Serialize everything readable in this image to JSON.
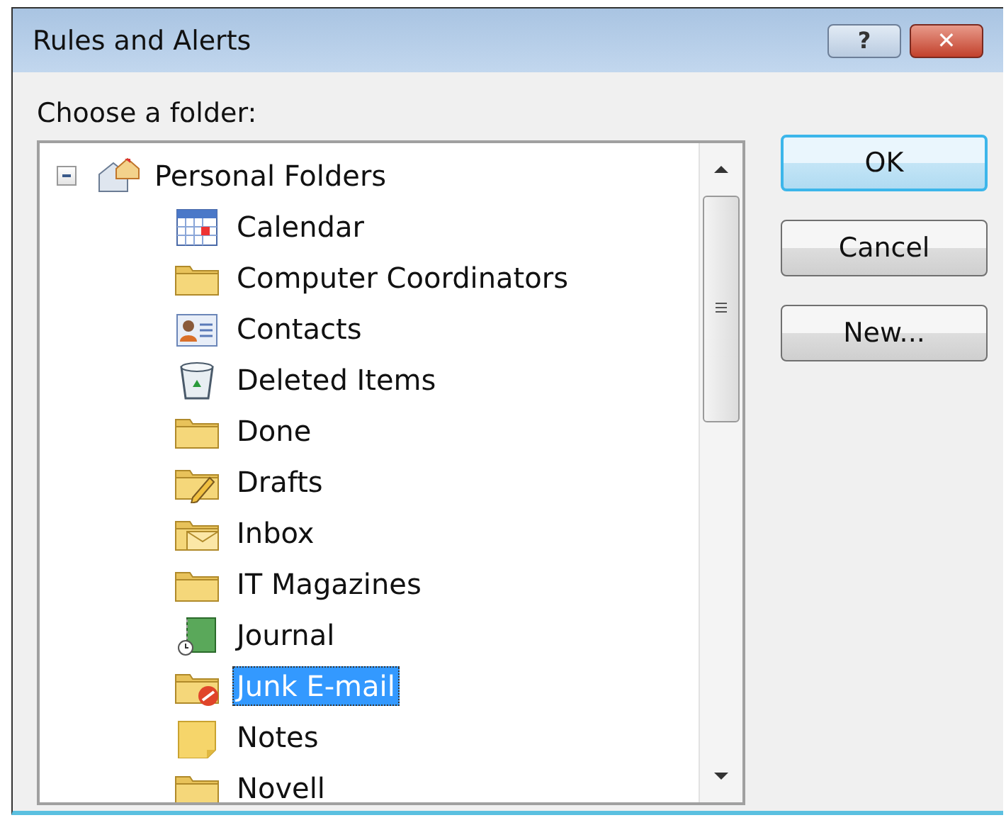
{
  "window": {
    "title": "Rules and Alerts"
  },
  "title_buttons": [
    {
      "kind": "help",
      "label": "?"
    },
    {
      "kind": "close",
      "label": "✕"
    }
  ],
  "folder_label": "Choose a folder:",
  "tree": [
    {
      "label": "Personal Folders",
      "kind": "root",
      "expanded": true,
      "selected": false,
      "children": [
        {
          "label": "Calendar",
          "kind": "calendar",
          "selected": false
        },
        {
          "label": "Computer Coordinators",
          "kind": "folder",
          "selected": false
        },
        {
          "label": "Contacts",
          "kind": "contacts",
          "selected": false
        },
        {
          "label": "Deleted Items",
          "kind": "deleted",
          "selected": false
        },
        {
          "label": "Done",
          "kind": "folder",
          "selected": false
        },
        {
          "label": "Drafts",
          "kind": "drafts",
          "selected": false
        },
        {
          "label": "Inbox",
          "kind": "inbox",
          "selected": false
        },
        {
          "label": "IT Magazines",
          "kind": "folder",
          "selected": false
        },
        {
          "label": "Journal",
          "kind": "journal",
          "selected": false
        },
        {
          "label": "Junk E-mail",
          "kind": "junk",
          "selected": true
        },
        {
          "label": "Notes",
          "kind": "notes",
          "selected": false
        },
        {
          "label": "Novell",
          "kind": "folder",
          "selected": false
        }
      ]
    }
  ],
  "buttons": [
    {
      "label": "OK",
      "default": true
    },
    {
      "label": "Cancel",
      "default": false
    },
    {
      "label": "New...",
      "default": false
    }
  ]
}
